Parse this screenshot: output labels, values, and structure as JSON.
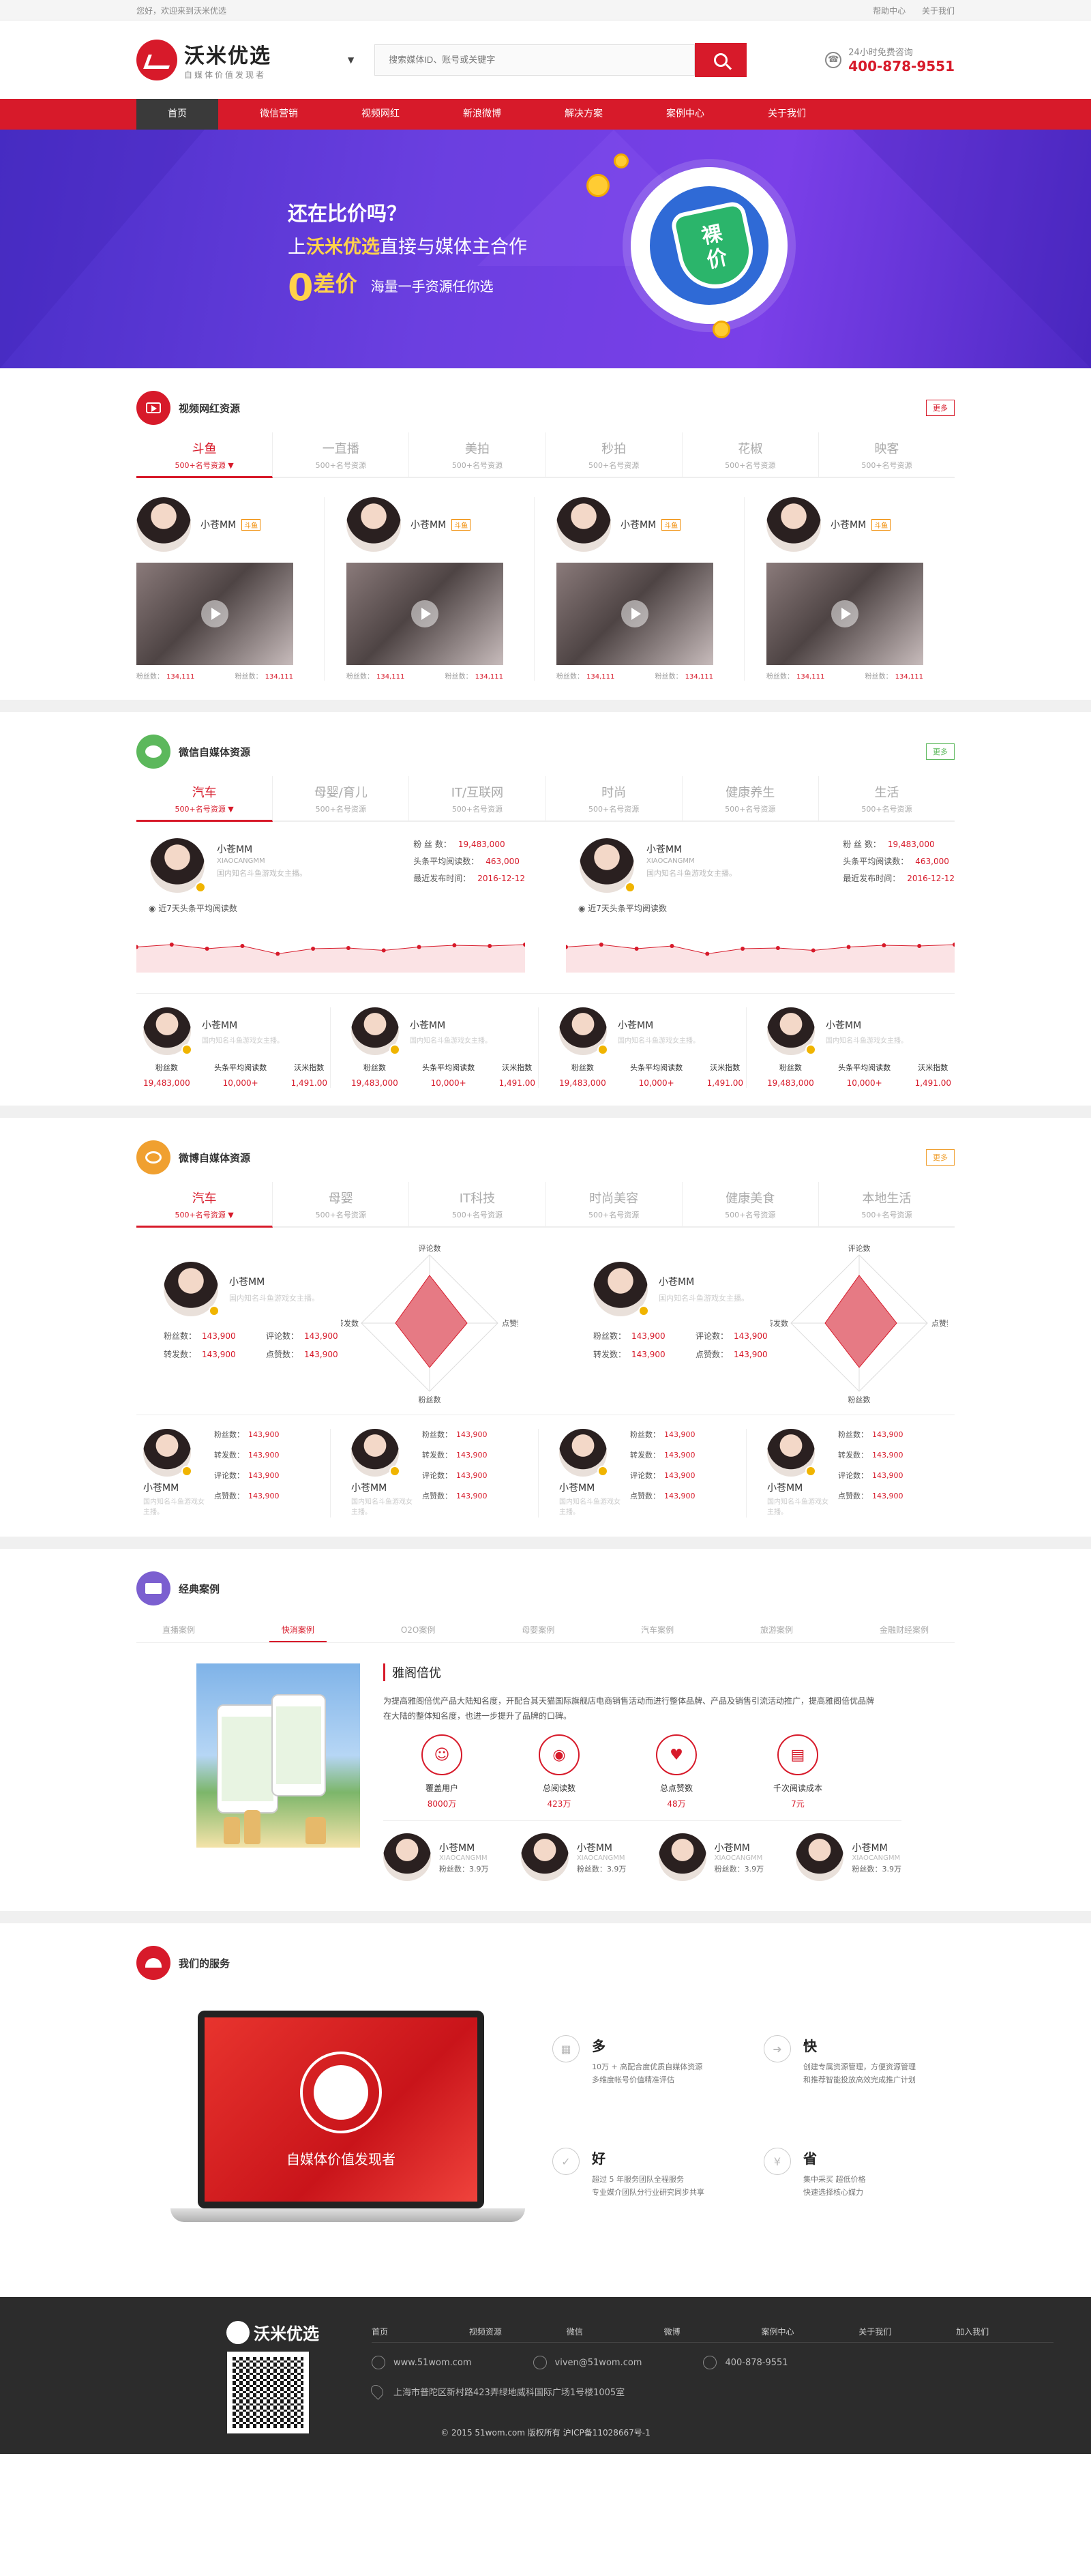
{
  "topbar": {
    "welcome": "您好，欢迎来到沃米优选",
    "links": [
      "帮助中心",
      "关于我们"
    ]
  },
  "header": {
    "logo_title": "沃米优选",
    "logo_slogan": "自媒体价值发现者",
    "search_placeholder": "搜索媒体ID、账号或关键字",
    "hotline_label": "24小时免费咨询",
    "hotline_number": "400-878-9551"
  },
  "nav": [
    "首页",
    "微信营销",
    "视频网红",
    "新浪微博",
    "解决方案",
    "案例中心",
    "关于我们"
  ],
  "banner": {
    "line1": "还在比价吗？",
    "line2_pre": "上",
    "line2_brand": "沃米优选",
    "line2_post": "直接与媒体主合作",
    "zero": "0",
    "zero_label": "差价",
    "line3": "海量一手资源任你选",
    "shield_line1": "裸",
    "shield_line2": "价"
  },
  "colors": {
    "brand": "#d71a2a",
    "banner": "#6b3fe0",
    "wechat": "#5cb85c",
    "weibo": "#f0a030",
    "case": "#7b5fd0"
  },
  "video": {
    "title": "视频网红资源",
    "more": "更多",
    "tabs": [
      {
        "name": "斗鱼",
        "sub": "500+名号资源"
      },
      {
        "name": "一直播",
        "sub": "500+名号资源"
      },
      {
        "name": "美拍",
        "sub": "500+名号资源"
      },
      {
        "name": "秒拍",
        "sub": "500+名号资源"
      },
      {
        "name": "花椒",
        "sub": "500+名号资源"
      },
      {
        "name": "映客",
        "sub": "500+名号资源"
      }
    ],
    "cards": [
      {
        "name": "小苍MM",
        "tag": "斗鱼",
        "fans_label": "粉丝数：",
        "fans": "134,111",
        "fans2_label": "粉丝数：",
        "fans2": "134,111"
      },
      {
        "name": "小苍MM",
        "tag": "斗鱼",
        "fans_label": "粉丝数：",
        "fans": "134,111",
        "fans2_label": "粉丝数：",
        "fans2": "134,111"
      },
      {
        "name": "小苍MM",
        "tag": "斗鱼",
        "fans_label": "粉丝数：",
        "fans": "134,111",
        "fans2_label": "粉丝数：",
        "fans2": "134,111"
      },
      {
        "name": "小苍MM",
        "tag": "斗鱼",
        "fans_label": "粉丝数：",
        "fans": "134,111",
        "fans2_label": "粉丝数：",
        "fans2": "134,111"
      }
    ]
  },
  "wechat": {
    "title": "微信自媒体资源",
    "more": "更多",
    "tabs": [
      {
        "name": "汽车",
        "sub": "500+名号资源"
      },
      {
        "name": "母婴/育儿",
        "sub": "500+名号资源"
      },
      {
        "name": "IT/互联网",
        "sub": "500+名号资源"
      },
      {
        "name": "时尚",
        "sub": "500+名号资源"
      },
      {
        "name": "健康养生",
        "sub": "500+名号资源"
      },
      {
        "name": "生活",
        "sub": "500+名号资源"
      }
    ],
    "featured": [
      {
        "name": "小苍MM",
        "en": "XIAOCANGMM",
        "desc": "国内知名斗鱼游戏女主播。",
        "fans_label": "粉 丝 数：",
        "fans": "19,483,000",
        "read_label": "头条平均阅读数：",
        "read": "463,000",
        "date_label": "最近发布时间：",
        "date": "2016-12-12",
        "chart_label": "近7天头条平均阅读数"
      },
      {
        "name": "小苍MM",
        "en": "XIAOCANGMM",
        "desc": "国内知名斗鱼游戏女主播。",
        "fans_label": "粉 丝 数：",
        "fans": "19,483,000",
        "read_label": "头条平均阅读数：",
        "read": "463,000",
        "date_label": "最近发布时间：",
        "date": "2016-12-12",
        "chart_label": "近7天头条平均阅读数"
      }
    ],
    "trend": [
      0.55,
      0.62,
      0.5,
      0.58,
      0.35,
      0.5,
      0.52,
      0.45,
      0.55,
      0.6,
      0.58,
      0.62
    ],
    "cards": [
      {
        "name": "小苍MM",
        "desc": "国内知名斗鱼游戏女主播。",
        "k1": "粉丝数",
        "v1": "19,483,000",
        "k2": "头条平均阅读数",
        "v2": "10,000+",
        "k3": "沃米指数",
        "v3": "1,491.00"
      },
      {
        "name": "小苍MM",
        "desc": "国内知名斗鱼游戏女主播。",
        "k1": "粉丝数",
        "v1": "19,483,000",
        "k2": "头条平均阅读数",
        "v2": "10,000+",
        "k3": "沃米指数",
        "v3": "1,491.00"
      },
      {
        "name": "小苍MM",
        "desc": "国内知名斗鱼游戏女主播。",
        "k1": "粉丝数",
        "v1": "19,483,000",
        "k2": "头条平均阅读数",
        "v2": "10,000+",
        "k3": "沃米指数",
        "v3": "1,491.00"
      },
      {
        "name": "小苍MM",
        "desc": "国内知名斗鱼游戏女主播。",
        "k1": "粉丝数",
        "v1": "19,483,000",
        "k2": "头条平均阅读数",
        "v2": "10,000+",
        "k3": "沃米指数",
        "v3": "1,491.00"
      }
    ]
  },
  "weibo": {
    "title": "微博自媒体资源",
    "more": "更多",
    "tabs": [
      {
        "name": "汽车",
        "sub": "500+名号资源"
      },
      {
        "name": "母婴",
        "sub": "500+名号资源"
      },
      {
        "name": "IT科技",
        "sub": "500+名号资源"
      },
      {
        "name": "时尚美容",
        "sub": "500+名号资源"
      },
      {
        "name": "健康美食",
        "sub": "500+名号资源"
      },
      {
        "name": "本地生活",
        "sub": "500+名号资源"
      }
    ],
    "featured": [
      {
        "name": "小苍MM",
        "desc": "国内知名斗鱼游戏女主播。",
        "k1": "粉丝数：",
        "v1": "143,900",
        "k2": "评论数：",
        "v2": "143,900",
        "k3": "转发数：",
        "v3": "143,900",
        "k4": "点赞数：",
        "v4": "143,900",
        "radar_top": "评论数",
        "radar_right": "点赞数",
        "radar_bottom": "粉丝数",
        "radar_left": "转发数"
      },
      {
        "name": "小苍MM",
        "desc": "国内知名斗鱼游戏女主播。",
        "k1": "粉丝数：",
        "v1": "143,900",
        "k2": "评论数：",
        "v2": "143,900",
        "k3": "转发数：",
        "v3": "143,900",
        "k4": "点赞数：",
        "v4": "143,900",
        "radar_top": "评论数",
        "radar_right": "点赞数",
        "radar_bottom": "粉丝数",
        "radar_left": "转发数"
      }
    ],
    "cards": [
      {
        "name": "小苍MM",
        "desc": "国内知名斗鱼游戏女主播。",
        "k1": "粉丝数：",
        "v1": "143,900",
        "k2": "转发数：",
        "v2": "143,900",
        "k3": "评论数：",
        "v3": "143,900",
        "k4": "点赞数：",
        "v4": "143,900"
      },
      {
        "name": "小苍MM",
        "desc": "国内知名斗鱼游戏女主播。",
        "k1": "粉丝数：",
        "v1": "143,900",
        "k2": "转发数：",
        "v2": "143,900",
        "k3": "评论数：",
        "v3": "143,900",
        "k4": "点赞数：",
        "v4": "143,900"
      },
      {
        "name": "小苍MM",
        "desc": "国内知名斗鱼游戏女主播。",
        "k1": "粉丝数：",
        "v1": "143,900",
        "k2": "转发数：",
        "v2": "143,900",
        "k3": "评论数：",
        "v3": "143,900",
        "k4": "点赞数：",
        "v4": "143,900"
      },
      {
        "name": "小苍MM",
        "desc": "国内知名斗鱼游戏女主播。",
        "k1": "粉丝数：",
        "v1": "143,900",
        "k2": "转发数：",
        "v2": "143,900",
        "k3": "评论数：",
        "v3": "143,900",
        "k4": "点赞数：",
        "v4": "143,900"
      }
    ]
  },
  "cases": {
    "title": "经典案例",
    "tabs": [
      "直播案例",
      "快消案例",
      "O2O案例",
      "母婴案例",
      "汽车案例",
      "旅游案例",
      "金融财经案例"
    ],
    "case_title": "雅阁倍优",
    "desc": "为提高雅阁倍优产品大陆知名度，开配合其天猫国际旗舰店电商销售活动而进行整体品牌、产品及销售引流活动推广，提高雅阁倍优品牌在大陆的整体知名度，也进一步提升了品牌的口碑。",
    "stats": [
      {
        "icon": "users-icon",
        "glyph": "☺",
        "k": "覆盖用户",
        "v": "8000万"
      },
      {
        "icon": "eye-icon",
        "glyph": "◉",
        "k": "总阅读数",
        "v": "423万"
      },
      {
        "icon": "thumbs-up-icon",
        "glyph": "♥",
        "k": "总点赞数",
        "v": "48万"
      },
      {
        "icon": "book-icon",
        "glyph": "▤",
        "k": "千次阅读成本",
        "v": "7元"
      }
    ],
    "people": [
      {
        "name": "小苍MM",
        "en": "XIAOCANGMM",
        "fans": "粉丝数：3.9万"
      },
      {
        "name": "小苍MM",
        "en": "XIAOCANGMM",
        "fans": "粉丝数：3.9万"
      },
      {
        "name": "小苍MM",
        "en": "XIAOCANGMM",
        "fans": "粉丝数：3.9万"
      },
      {
        "name": "小苍MM",
        "en": "XIAOCANGMM",
        "fans": "粉丝数：3.9万"
      }
    ]
  },
  "services": {
    "title": "我们的服务",
    "laptop_text": "自媒体价值发现者",
    "items": [
      {
        "icon": "many-icon",
        "glyph": "▦",
        "h": "多",
        "p1": "10万 + 高配合度优质自媒体资源",
        "p2": "多维度帐号价值精准评估"
      },
      {
        "icon": "fast-icon",
        "glyph": "➜",
        "h": "快",
        "p1": "创建专属资源管理，方便资源管理",
        "p2": "和推荐智能投放高效完成推广计划"
      },
      {
        "icon": "good-icon",
        "glyph": "✓",
        "h": "好",
        "p1": "超过 5 年服务团队全程服务",
        "p2": "专业媒介团队分行业研究同步共享"
      },
      {
        "icon": "save-icon",
        "glyph": "¥",
        "h": "省",
        "p1": "集中采买 超低价格",
        "p2": "快速选择核心媒力"
      }
    ]
  },
  "footer": {
    "logo": "沃米优选",
    "nav": [
      "首页",
      "视频资源",
      "微信",
      "微博",
      "案例中心",
      "关于我们",
      "加入我们"
    ],
    "site": "www.51wom.com",
    "email": "viven@51wom.com",
    "phone": "400-878-9551",
    "address": "上海市普陀区新村路423弄绿地威科国际广场1号楼1005室",
    "copyright": "© 2015 51wom.com 版权所有 沪ICP备11028667号-1"
  }
}
